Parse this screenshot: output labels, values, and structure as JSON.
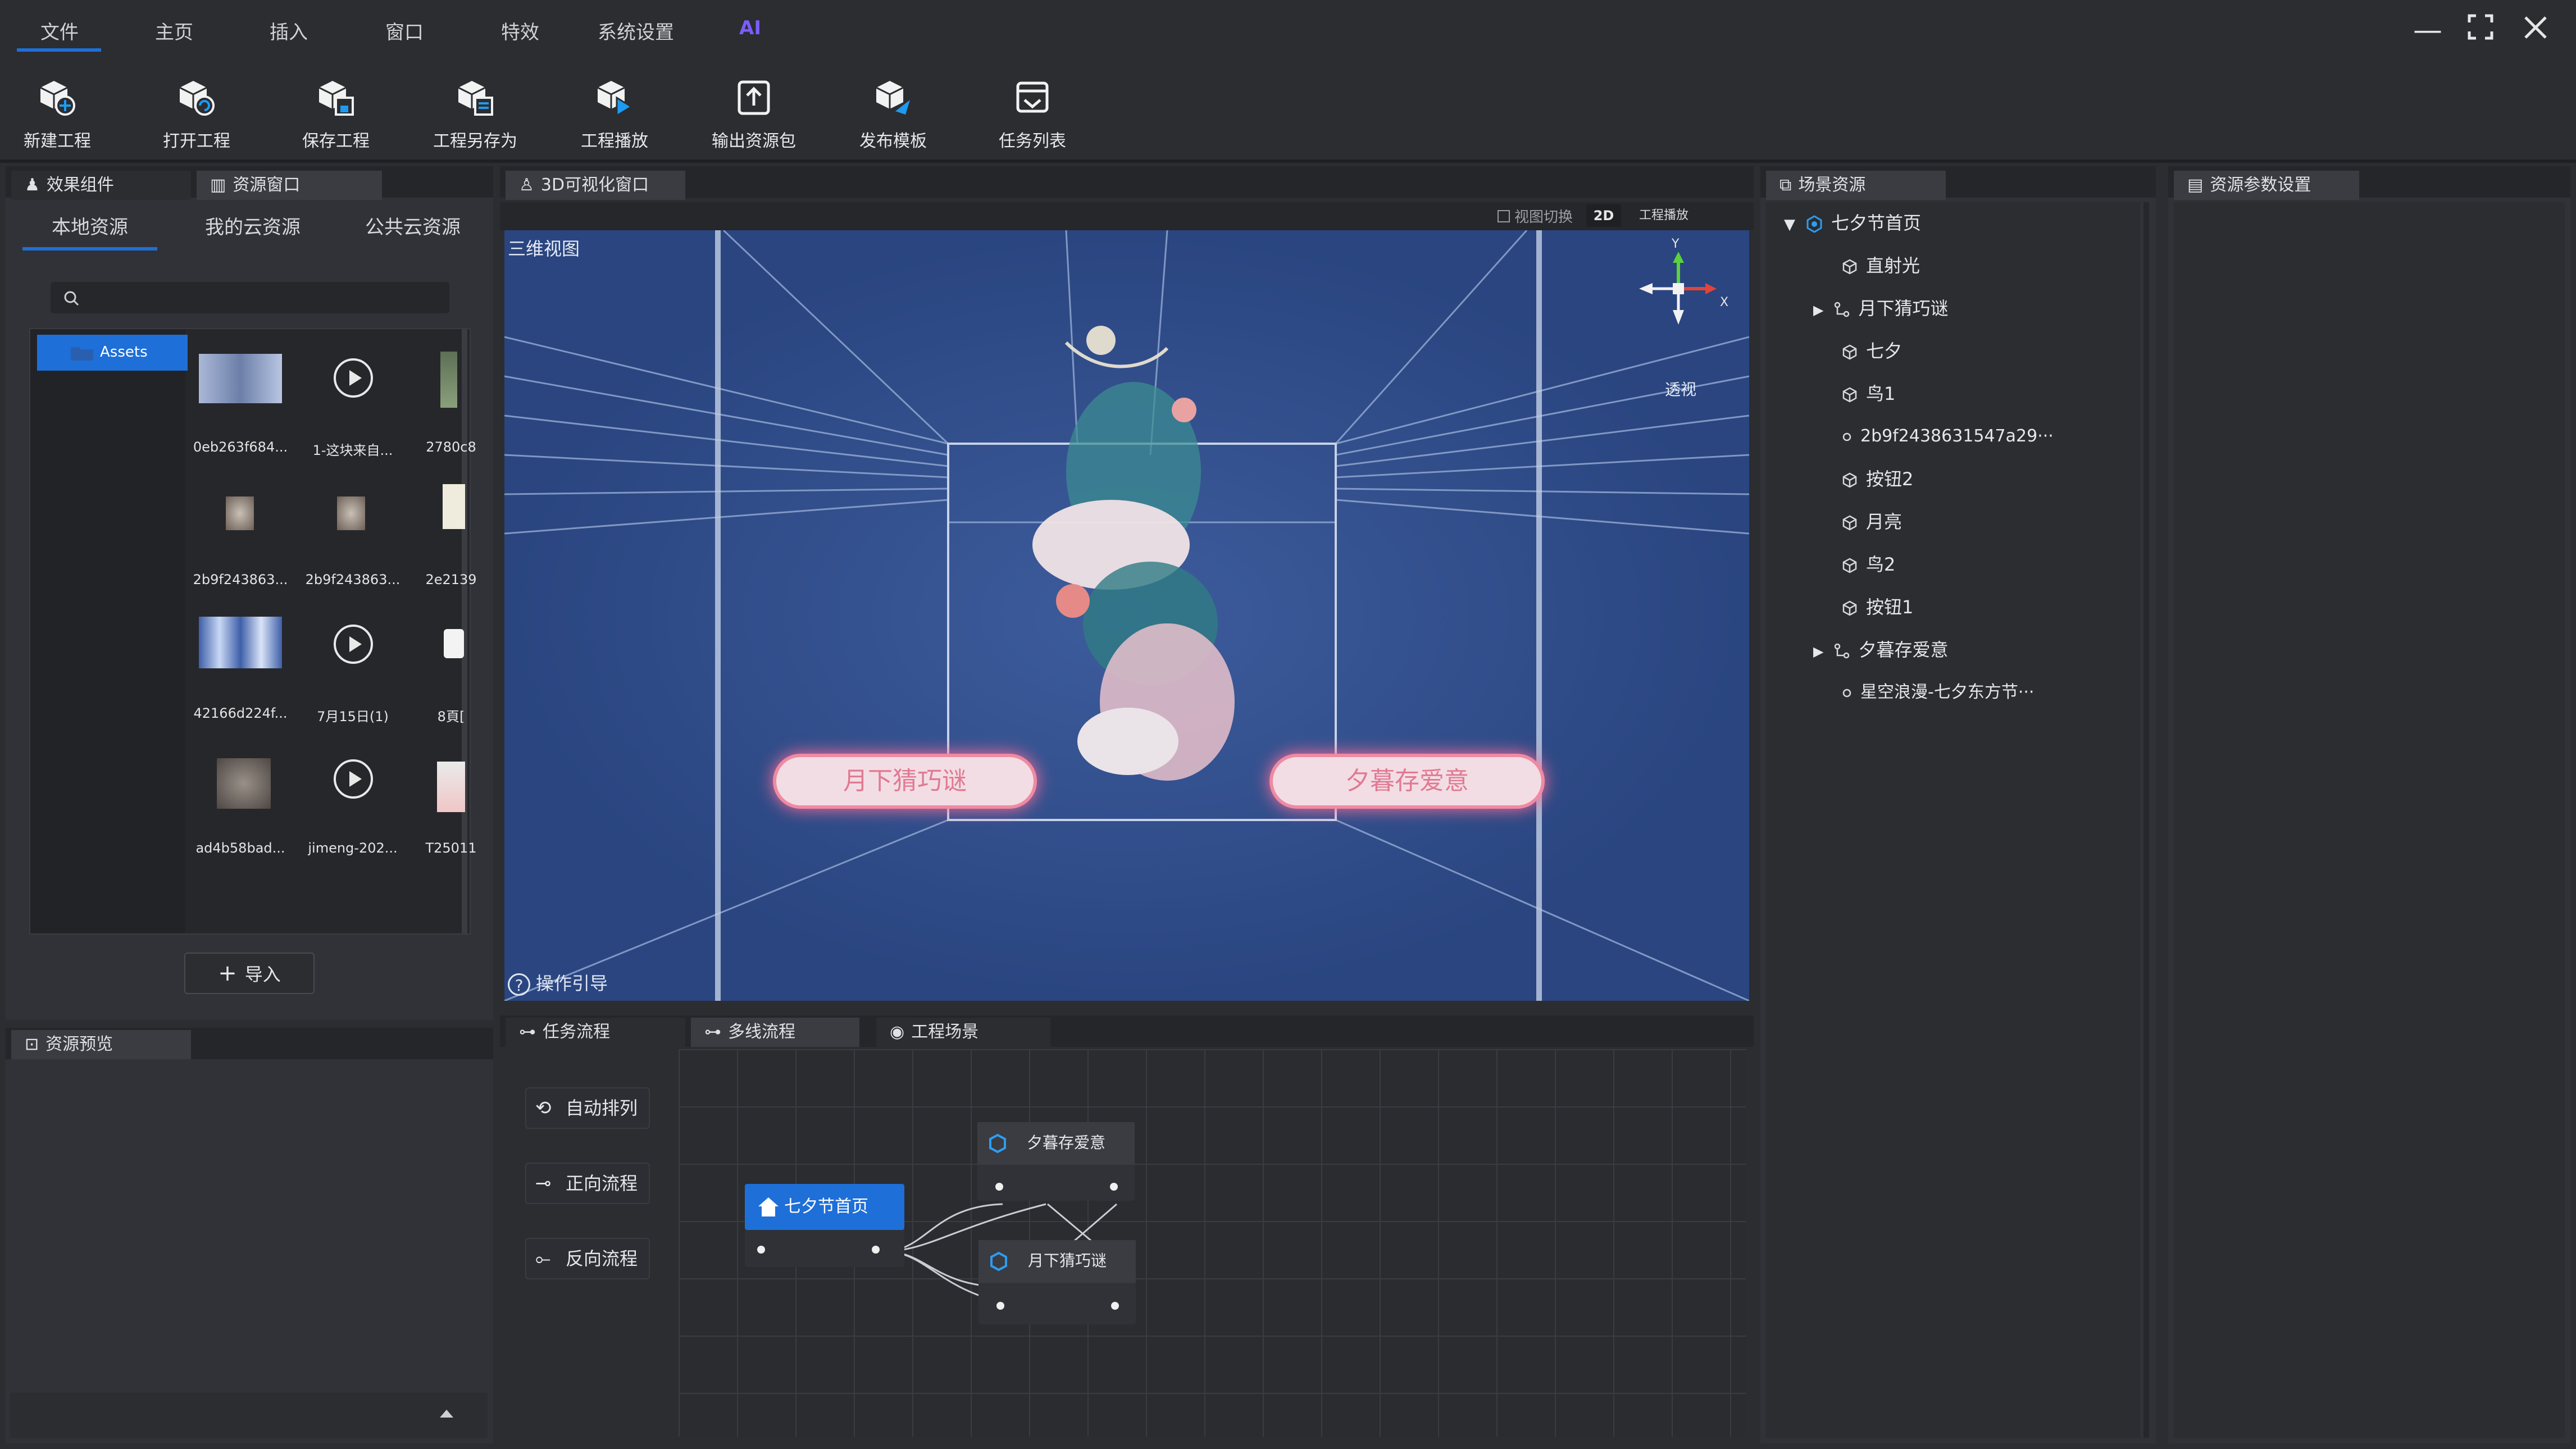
{
  "menu": {
    "items": [
      "文件",
      "主页",
      "插入",
      "窗口",
      "特效",
      "系统设置",
      "AI"
    ],
    "active_index": 0
  },
  "toolbar": {
    "buttons": [
      "新建工程",
      "打开工程",
      "保存工程",
      "工程另存为",
      "工程播放",
      "输出资源包",
      "发布模板",
      "任务列表"
    ]
  },
  "left_panel": {
    "tabs": [
      "效果组件",
      "资源窗口"
    ],
    "subtabs": [
      "本地资源",
      "我的云资源",
      "公共云资源"
    ],
    "active_subtab": 0,
    "search_placeholder": "",
    "folder": "Assets",
    "assets": [
      {
        "label": "0eb263f684...",
        "kind": "image"
      },
      {
        "label": "1-这块来自...",
        "kind": "video"
      },
      {
        "label": "2780c8",
        "kind": "image"
      },
      {
        "label": "2b9f243863...",
        "kind": "image"
      },
      {
        "label": "2b9f243863...",
        "kind": "image"
      },
      {
        "label": "2e2139",
        "kind": "image"
      },
      {
        "label": "42166d224f...",
        "kind": "image"
      },
      {
        "label": "7月15日(1)",
        "kind": "video"
      },
      {
        "label": "8頁[",
        "kind": "image"
      },
      {
        "label": "ad4b58bad...",
        "kind": "image"
      },
      {
        "label": "jimeng-202...",
        "kind": "video"
      },
      {
        "label": "T25011",
        "kind": "image"
      }
    ],
    "import_label": "导入"
  },
  "preview_panel": {
    "title": "资源预览"
  },
  "viewport": {
    "title": "3D可视化窗口",
    "view_switch_label": "视图切换",
    "mode_2d": "2D",
    "play_label": "工程播放",
    "corner_label": "三维视图",
    "perspective_label": "透视",
    "axis_x": "X",
    "axis_y": "Y",
    "scene_button_left": "月下猜巧谜",
    "scene_button_right": "夕暮存爱意",
    "guide_label": "操作引导"
  },
  "flow_panel": {
    "tabs": [
      "任务流程",
      "多线流程",
      "工程场景"
    ],
    "buttons": [
      "自动排列",
      "正向流程",
      "反向流程"
    ],
    "nodes": [
      "七夕节首页",
      "夕暮存爱意",
      "月下猜巧谜"
    ]
  },
  "scene_panel": {
    "title": "场景资源",
    "tree": [
      {
        "label": "七夕节首页",
        "level": 0,
        "expander": "▼",
        "icon": "scene"
      },
      {
        "label": "直射光",
        "level": 1,
        "expander": "",
        "icon": "cube"
      },
      {
        "label": "月下猜巧谜",
        "level": 1,
        "expander": "▶",
        "icon": "link"
      },
      {
        "label": "七夕",
        "level": 1,
        "expander": "",
        "icon": "cube"
      },
      {
        "label": "鸟1",
        "level": 1,
        "expander": "",
        "icon": "cube"
      },
      {
        "label": "2b9f2438631547a29···",
        "level": 1,
        "expander": "",
        "icon": "small"
      },
      {
        "label": "按钮2",
        "level": 1,
        "expander": "",
        "icon": "cube"
      },
      {
        "label": "月亮",
        "level": 1,
        "expander": "",
        "icon": "cube"
      },
      {
        "label": "鸟2",
        "level": 1,
        "expander": "",
        "icon": "cube"
      },
      {
        "label": "按钮1",
        "level": 1,
        "expander": "",
        "icon": "cube"
      },
      {
        "label": "夕暮存爱意",
        "level": 1,
        "expander": "▶",
        "icon": "link"
      },
      {
        "label": "星空浪漫-七夕东方节···",
        "level": 1,
        "expander": "",
        "icon": "small"
      }
    ]
  },
  "params_panel": {
    "title": "资源参数设置"
  },
  "colors": {
    "accent": "#1e6fd8",
    "ai": "#7b5cff",
    "viewport_bg": "#2e4a85",
    "button_pink": "#f1d6df"
  }
}
